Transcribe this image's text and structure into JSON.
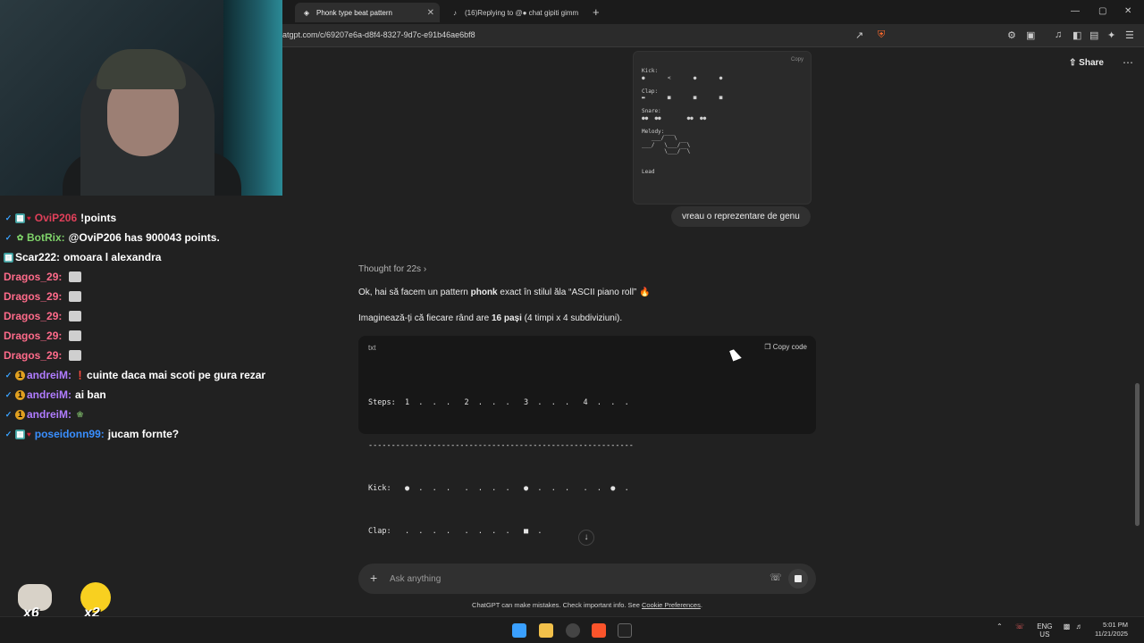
{
  "browser": {
    "tabs": [
      {
        "label": "Phonk type beat pattern",
        "active": true
      },
      {
        "label": "(16)Replying to @● chat gipiti gimm",
        "active": false
      }
    ],
    "new_tab": "+",
    "url": "atgpt.com/c/69207e6a-d8f4-8327-9d7c-e91b46ae6bf8",
    "window_controls": [
      "—",
      "▢",
      "✕"
    ]
  },
  "stream_chat": {
    "messages": [
      {
        "badges": [
          "sword",
          "green",
          "heart"
        ],
        "user": "OviP206",
        "user_color": "#e0405a",
        "text": "!points"
      },
      {
        "badges": [
          "sword",
          "bot"
        ],
        "user": "BotRix:",
        "user_color": "#7fd36a",
        "text": "@OviP206 has 900043 points."
      },
      {
        "badges": [
          "green"
        ],
        "user": "Scar222:",
        "user_color": "#ffffff",
        "text": "omoara l alexandra"
      },
      {
        "badges": [],
        "user": "Dragos_29:",
        "user_color": "#ff6b8a",
        "text": "",
        "emote": "cat"
      },
      {
        "badges": [],
        "user": "Dragos_29:",
        "user_color": "#ff6b8a",
        "text": "",
        "emote": "cat"
      },
      {
        "badges": [],
        "user": "Dragos_29:",
        "user_color": "#ff6b8a",
        "text": "",
        "emote": "cat"
      },
      {
        "badges": [],
        "user": "Dragos_29:",
        "user_color": "#ff6b8a",
        "text": "",
        "emote": "cat"
      },
      {
        "badges": [],
        "user": "Dragos_29:",
        "user_color": "#ff6b8a",
        "text": "",
        "emote": "cat"
      },
      {
        "badges": [
          "sword",
          "one"
        ],
        "user": "andreiM:",
        "user_color": "#b07cff",
        "text": "cuinte daca mai scoti pe gura rezar",
        "emote": "red"
      },
      {
        "badges": [
          "sword",
          "one"
        ],
        "user": "andreiM:",
        "user_color": "#b07cff",
        "text": "ai ban"
      },
      {
        "badges": [
          "sword",
          "one"
        ],
        "user": "andreiM:",
        "user_color": "#b07cff",
        "text": "",
        "emote": "turtle"
      },
      {
        "badges": [
          "sword",
          "green",
          "heart"
        ],
        "user": "poseidonn99:",
        "user_color": "#3a8fff",
        "text": "jucam fornte?"
      }
    ],
    "emote_counters": [
      "x6",
      "x2"
    ]
  },
  "chatgpt": {
    "share_label": "Share",
    "image_card": {
      "copy_label": "Copy",
      "ascii": "Kick:\n●       <       ●       ●\n\nClap:\n▬       ■       ■       ■\n\nSnare:\n●●  ●●        ●●  ●●\n\nMelody:\n   ___/‾‾‾\\\n___/   \\___/‾‾\\\n       \\___/‾‾\\\n\n\nLead"
    },
    "user_message": "vreau o reprezentare de genu",
    "thought_label": "Thought for 22s",
    "paragraph1": {
      "pre": "Ok, hai să facem un pattern ",
      "bold": "phonk",
      "post": " exact în stilul ăla “ASCII piano roll” 🔥"
    },
    "paragraph2": {
      "pre": "Imaginează-ți că fiecare rând are ",
      "bold": "16 pași",
      "post": " (4 timpi x 4 subdiviziuni)."
    },
    "code_block": {
      "language": "txt",
      "copy_label": "Copy code",
      "lines": [
        "Steps:  1  .  .  .   2  .  .  .   3  .  .  .   4  .  .  .",
        "----------------------------------------------------------",
        "Kick:   ●  .  .  .   .  .  .  .   ●  .  .  .   .  .  ●  .",
        "Clap:   .  .  .  .   .  .  .  .   ■  ."
      ]
    },
    "composer_placeholder": "Ask anything",
    "disclaimer_pre": "ChatGPT can make mistakes. Check important info. See ",
    "disclaimer_link": "Cookie Preferences",
    "disclaimer_post": "."
  },
  "taskbar": {
    "language": "ENG",
    "region": "US",
    "time": "5:01 PM",
    "date": "11/21/2025"
  },
  "colors": {
    "bg": "#212121",
    "code_bg": "#171717",
    "bubble": "#303030"
  }
}
